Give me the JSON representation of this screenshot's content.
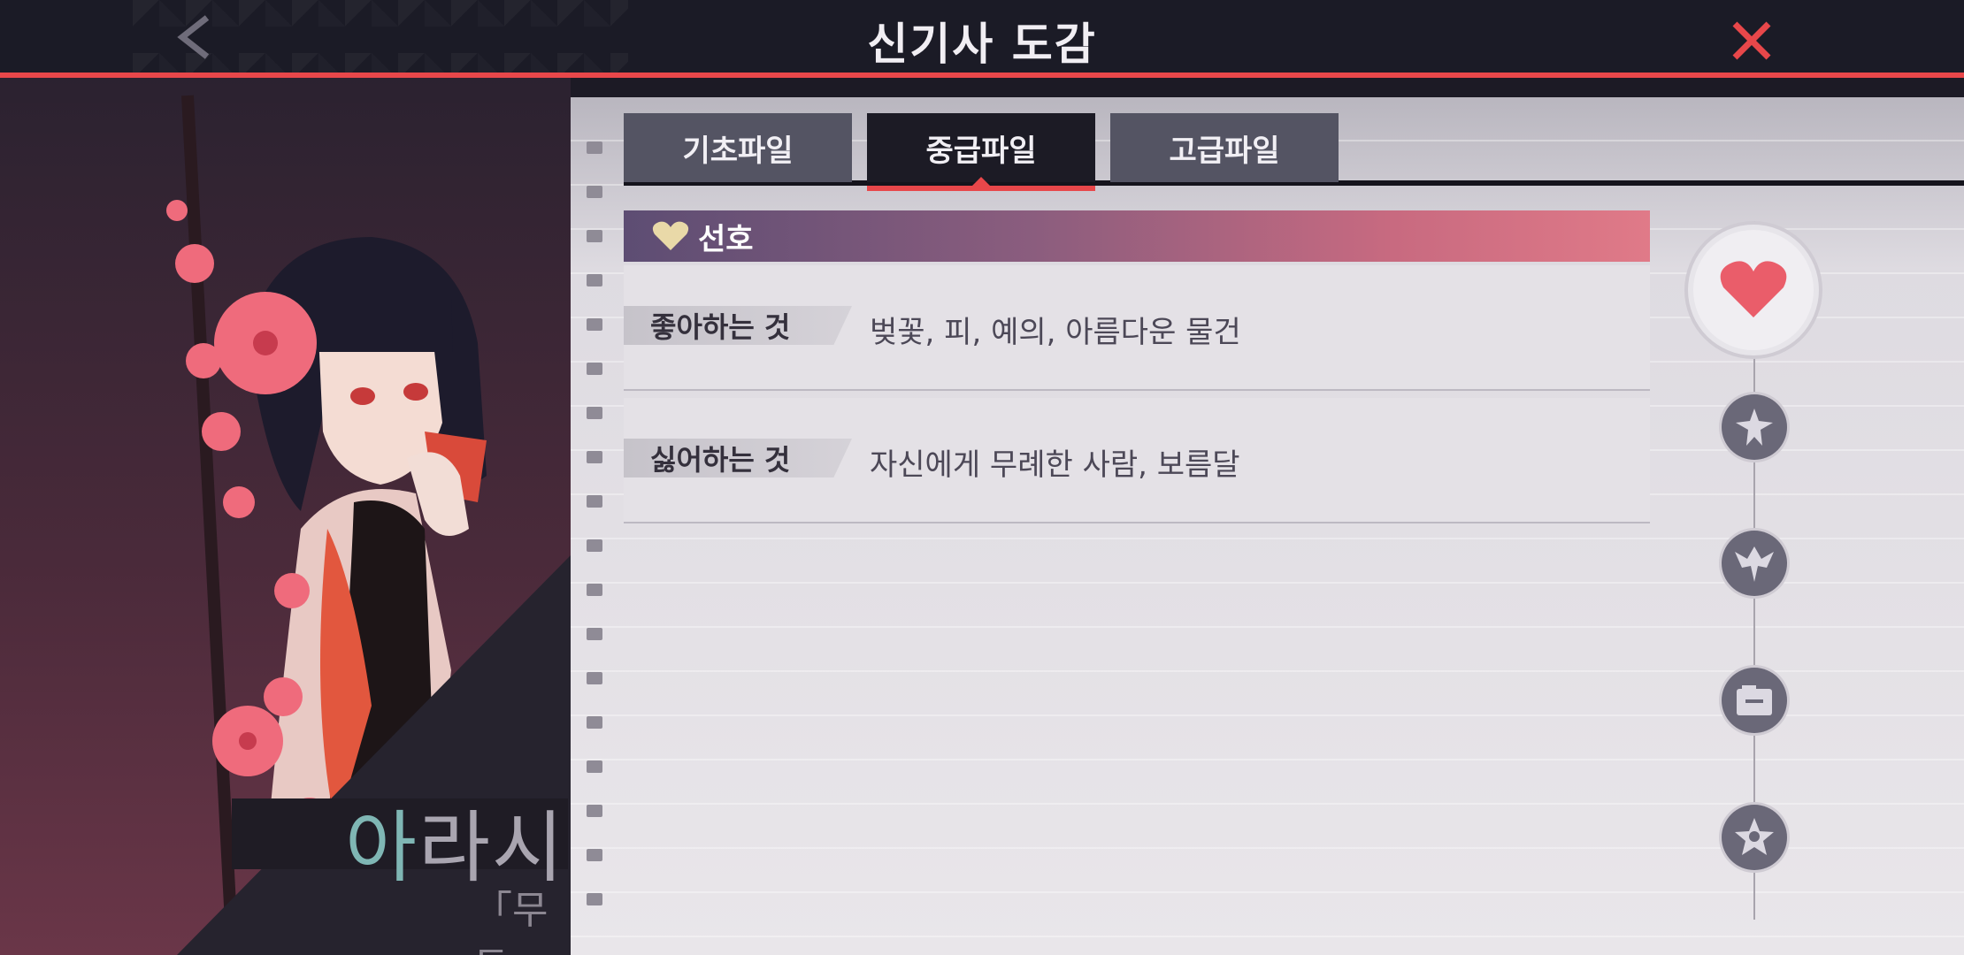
{
  "header": {
    "title": "신기사 도감"
  },
  "tabs": [
    {
      "label": "기초파일",
      "active": false
    },
    {
      "label": "중급파일",
      "active": true
    },
    {
      "label": "고급파일",
      "active": false
    }
  ],
  "section": {
    "title": "선호"
  },
  "preferences": [
    {
      "tag": "좋아하는 것",
      "value": "벚꽃, 피, 예의, 아름다운 물건"
    },
    {
      "tag": "싫어하는 것",
      "value": "자신에게 무례한 사람, 보름달"
    }
  ],
  "character": {
    "name_first": "아",
    "name_rest": "라시",
    "subtitle": "「무두」"
  },
  "nav": {
    "items": [
      "heart-icon",
      "sword-emblem-icon",
      "wings-emblem-icon",
      "folder-icon",
      "star-badge-icon"
    ],
    "active": "heart-icon"
  },
  "colors": {
    "accent": "#e8474a",
    "header_bg": "#1b1b26",
    "tab_active": "#1c1b25",
    "tab_inactive": "#545463"
  }
}
